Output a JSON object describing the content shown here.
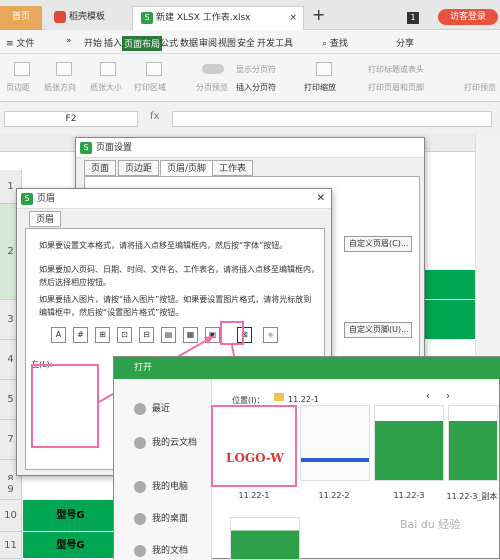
{
  "tabs": {
    "home": "首页",
    "template": "稻壳模板",
    "doc": "新建 XLSX 工作表.xlsx",
    "close": "×",
    "add": "+",
    "page_num": "1",
    "login": "访客登录"
  },
  "menu": {
    "file": "≡ 文件",
    "more": "»",
    "items": [
      "开始",
      "插入",
      "页面布局",
      "公式",
      "数据",
      "审阅",
      "视图",
      "安全",
      "开发工具"
    ],
    "search": "查找",
    "share": "分享"
  },
  "toolbar": {
    "margins": "页边距",
    "orientation": "纸张方向",
    "size": "纸张大小",
    "print_area": "打印区域",
    "page_preview": "分页预览",
    "show_break": "显示分页符",
    "insert_break": "插入分页符",
    "print_scale": "打印缩放",
    "print_title": "打印标题或表头",
    "print_header": "打印页眉和页脚",
    "print_preview": "打印预览"
  },
  "formula": {
    "cell": "F2",
    "fx": "fx"
  },
  "grid": {
    "rows": [
      "1",
      "2",
      "3",
      "4",
      "5",
      "6",
      "7",
      "8",
      "9",
      "10",
      "11"
    ],
    "model": "型号G",
    "r2_suffix": "4"
  },
  "page_setup": {
    "title": "页面设置",
    "tabs": [
      "页面",
      "页边距",
      "页眉/页脚",
      "工作表"
    ],
    "custom_header": "自定义页眉(C)...",
    "custom_footer": "自定义页脚(U)..."
  },
  "header_dlg": {
    "title": "页眉",
    "tab": "页眉",
    "p1": "如果要设置文本格式，请将插入点移至编辑框内，然后按“字体”按钮。",
    "p2": "如果要加入页码、日期、时间、文件名、工作表名，请将插入点移至编辑框内，然后选择相应按钮。",
    "p3": "如果要插入图片，请按“插入图片”按钮。如果要设置图片格式，请将光标放到编辑框中，然后按“设置图片格式”按钮。",
    "left_label": "左(L):",
    "icons": [
      "A",
      "#",
      "⊞",
      "⊡",
      "⊟",
      "▤",
      "▦",
      "▣",
      "⊠",
      "◈"
    ]
  },
  "open_dlg": {
    "title": "打开",
    "location_label": "位置(I)：",
    "folder": "11.22-1",
    "sidebar": [
      "最近",
      "我的云文档",
      "我的电脑",
      "我的桌面",
      "我的文档"
    ],
    "files": [
      "11.22-1",
      "11.22-2",
      "11.22-3",
      "11.22-3_副本"
    ],
    "logo": "LOGO-W"
  },
  "watermark": "Bai du 经验"
}
